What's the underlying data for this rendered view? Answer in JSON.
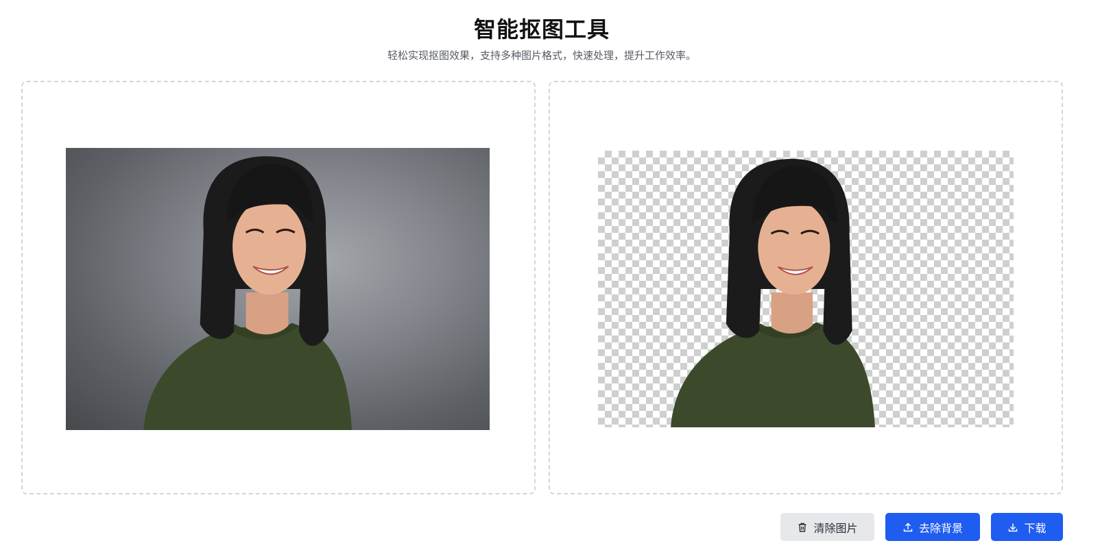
{
  "header": {
    "title": "智能抠图工具",
    "subtitle": "轻松实现抠图效果，支持多种图片格式，快速处理，提升工作效率。"
  },
  "panels": {
    "original": {
      "image_desc": "portrait of smiling woman with black bangs and green sweater on gray backdrop"
    },
    "result": {
      "image_desc": "same portrait with background removed over transparency checkerboard"
    }
  },
  "actions": {
    "clear_label": "清除图片",
    "remove_bg_label": "去除背景",
    "download_label": "下载"
  },
  "icons": {
    "clear": "trash-icon",
    "remove_bg": "upload-icon",
    "download": "download-icon"
  },
  "colors": {
    "primary": "#1f5cf0",
    "secondary_button": "#e6e8eb",
    "panel_border": "#d2d5da"
  }
}
